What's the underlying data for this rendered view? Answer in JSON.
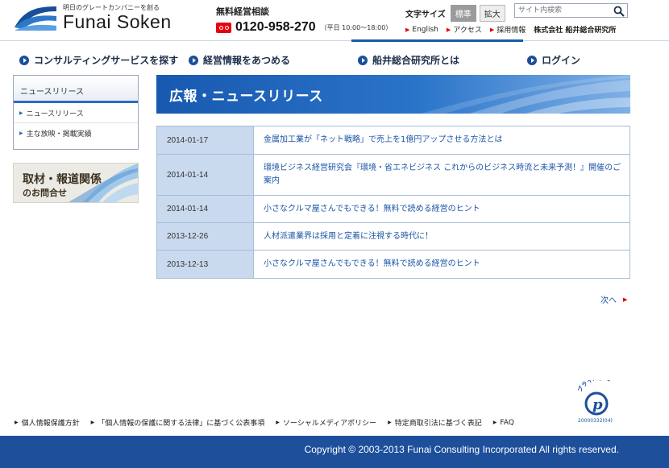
{
  "header": {
    "logo_tagline": "明日のグレートカンパニーを創る",
    "logo_name": "Funai Soken",
    "consult_label": "無料経営相談",
    "phone": "0120-958-270",
    "hours": "（平日 10:00～18:00）",
    "font_size_label": "文字サイズ",
    "font_size_standard": "標準",
    "font_size_large": "拡大",
    "search_placeholder": "サイト内検索",
    "util_links": [
      "English",
      "アクセス",
      "採用情報"
    ],
    "company_name": "株式会社 船井総合研究所"
  },
  "global_nav": [
    "コンサルティングサービスを探す",
    "経営情報をあつめる",
    "船井総合研究所とは",
    "ログイン"
  ],
  "sidebar": {
    "title": "ニュースリリース",
    "items": [
      "ニュースリリース",
      "主な放映・掲載実績"
    ],
    "banner_line1": "取材・報道関係",
    "banner_line2": "のお問合せ"
  },
  "main": {
    "page_title": "広報・ニュースリリース",
    "news": [
      {
        "date": "2014-01-17",
        "title": "金属加工業が「ネット戦略」で売上を1億円アップさせる方法とは"
      },
      {
        "date": "2014-01-14",
        "title": "環境ビジネス経営研究会『環境・省エネビジネス これからのビジネス時流と未来予測！』開催のご案内"
      },
      {
        "date": "2014-01-14",
        "title": "小さなクルマ屋さんでもできる！無料で読める経営のヒント"
      },
      {
        "date": "2013-12-26",
        "title": "人材派遣業界は採用と定着に注視する時代に！"
      },
      {
        "date": "2013-12-13",
        "title": "小さなクルマ屋さんでもできる！無料で読める経営のヒント"
      }
    ],
    "next_label": "次へ"
  },
  "footer": {
    "links": [
      "個人情報保護方針",
      "「個人情報の保護に関する法律」に基づく公表事項",
      "ソーシャルメディアポリシー",
      "特定商取引法に基づく表記",
      "FAQ"
    ],
    "privacy_mark_text": "プライバシー",
    "privacy_mark_number": "20000332(04)",
    "copyright": "Copyright © 2003-2013 Funai Consulting Incorporated All rights reserved."
  },
  "colors": {
    "brand_blue": "#1d4f9b",
    "accent_red": "#e8000d",
    "link_blue": "#1a55a5",
    "date_cell": "#c9d9ee"
  }
}
